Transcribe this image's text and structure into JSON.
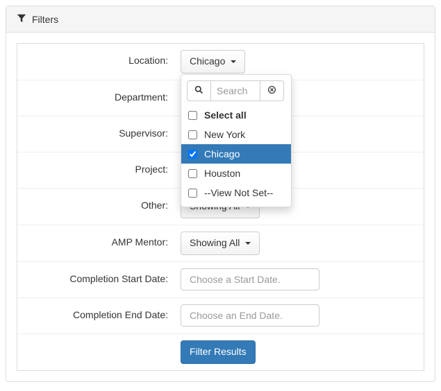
{
  "panel": {
    "title": "Filters"
  },
  "rows": {
    "location": {
      "label": "Location:",
      "button": "Chicago"
    },
    "department": {
      "label": "Department:"
    },
    "supervisor": {
      "label": "Supervisor:"
    },
    "project": {
      "label": "Project:"
    },
    "other": {
      "label": "Other:",
      "button": "Showing All"
    },
    "amp_mentor": {
      "label": "AMP Mentor:",
      "button": "Showing All"
    },
    "start_date": {
      "label": "Completion Start Date:",
      "placeholder": "Choose a Start Date."
    },
    "end_date": {
      "label": "Completion End Date:",
      "placeholder": "Choose an End Date."
    },
    "submit": {
      "label": "Filter Results"
    }
  },
  "location_dropdown": {
    "search_placeholder": "Search",
    "select_all_label": "Select all",
    "options": [
      {
        "label": "New York",
        "checked": false,
        "selected": false
      },
      {
        "label": "Chicago",
        "checked": true,
        "selected": true
      },
      {
        "label": "Houston",
        "checked": false,
        "selected": false
      },
      {
        "label": "--View Not Set--",
        "checked": false,
        "selected": false
      }
    ]
  },
  "colors": {
    "primary": "#337ab7"
  }
}
